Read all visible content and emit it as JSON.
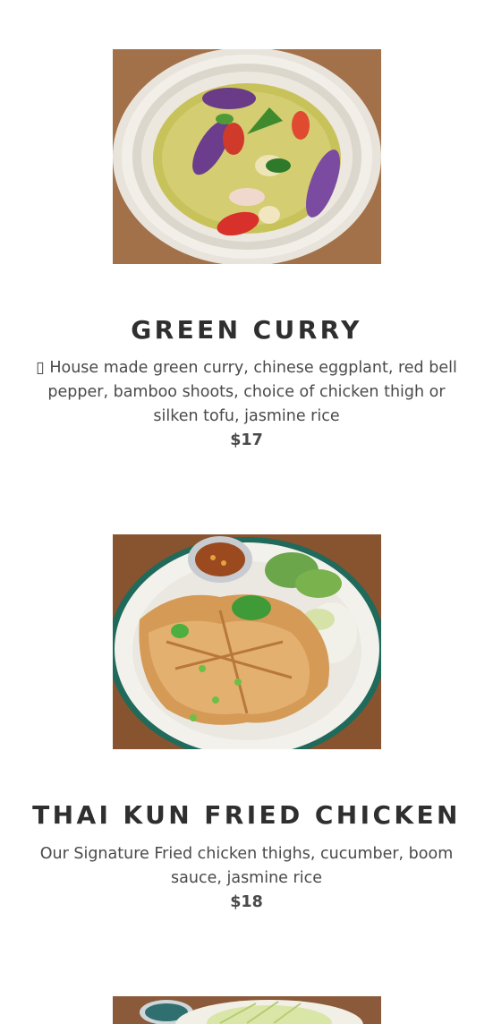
{
  "menu": {
    "items": [
      {
        "name": "GREEN CURRY",
        "description": "▯ House made green curry, chinese eggplant, red bell pepper, bamboo shoots, choice of chicken thigh or silken tofu, jasmine rice",
        "price": "$17",
        "image": "green-curry-photo"
      },
      {
        "name": "THAI KUN FRIED CHICKEN",
        "description": "Our Signature Fried chicken thighs, cucumber, boom sauce, jasmine rice",
        "price": "$18",
        "image": "fried-chicken-photo"
      },
      {
        "name": "",
        "description": "",
        "price": "",
        "image": "cabbage-dish-photo"
      }
    ]
  },
  "colors": {
    "title": "#2f2f2f",
    "text": "#4a4a4a",
    "background": "#ffffff"
  }
}
